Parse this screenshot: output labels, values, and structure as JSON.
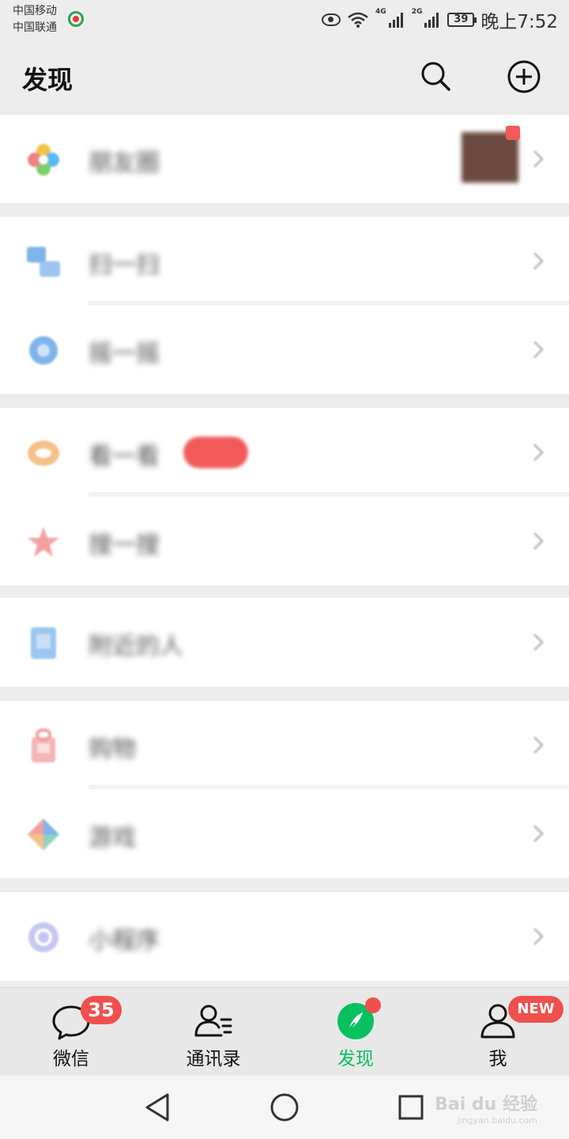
{
  "status_bar": {
    "carrier_1": "中国移动",
    "carrier_2": "中国联通",
    "network_1": "4G",
    "network_2": "2G",
    "battery": "39",
    "time": "晚上7:52"
  },
  "header": {
    "title": "发现",
    "search_icon": "search-icon",
    "add_icon": "plus-circle-icon"
  },
  "menu": {
    "rows": [
      {
        "label": "朋友圈",
        "icon": "moments-icon",
        "color": "#f5a623"
      },
      {
        "label": "扫一扫",
        "icon": "scan-icon",
        "color": "#3b8fe8"
      },
      {
        "label": "摇一摇",
        "icon": "shake-icon",
        "color": "#3b8fe8"
      },
      {
        "label": "看一看",
        "icon": "look-icon",
        "color": "#f0a23c"
      },
      {
        "label": "搜一搜",
        "icon": "search-star-icon",
        "color": "#e85a5a"
      },
      {
        "label": "附近的人",
        "icon": "nearby-icon",
        "color": "#3b8fe8"
      },
      {
        "label": "购物",
        "icon": "shopping-icon",
        "color": "#e85a5a"
      },
      {
        "label": "游戏",
        "icon": "games-icon",
        "color": "#52c0a8"
      },
      {
        "label": "小程序",
        "icon": "mini-program-icon",
        "color": "#7b7fe0"
      }
    ]
  },
  "tabbar": {
    "tabs": [
      {
        "label": "微信",
        "badge": "35"
      },
      {
        "label": "通讯录"
      },
      {
        "label": "发现",
        "active": true
      },
      {
        "label": "我",
        "badge": "NEW"
      }
    ]
  },
  "nav": {
    "watermark": "Bai du 经验",
    "watermark_sub": "jingyan.baidu.com"
  },
  "colors": {
    "accent": "#07c160",
    "badge": "#f0504d",
    "background": "#ededed"
  }
}
